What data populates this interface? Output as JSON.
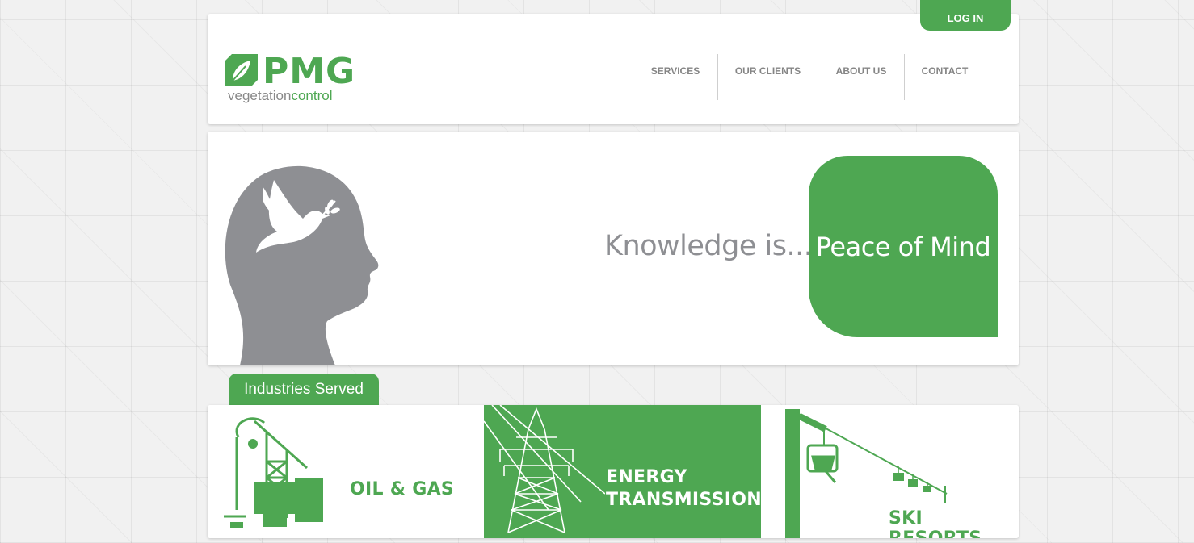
{
  "header": {
    "login_label": "LOG IN",
    "logo": {
      "brand": "PMG",
      "tagline_part1": "vegetation",
      "tagline_part2": "control"
    },
    "nav": [
      {
        "label": "SERVICES"
      },
      {
        "label": "OUR CLIENTS"
      },
      {
        "label": "ABOUT US"
      },
      {
        "label": "CONTACT"
      }
    ]
  },
  "hero": {
    "lead": "Knowledge is...",
    "highlight": "Peace of Mind",
    "illustration": "head-with-dove-icon"
  },
  "industries": {
    "tab_label": "Industries Served",
    "cards": [
      {
        "label": "OIL & GAS",
        "icon": "pumpjack-icon"
      },
      {
        "label_line1": "ENERGY",
        "label_line2": "TRANSMISSION",
        "icon": "power-tower-icon"
      },
      {
        "label": "SKI RESORTS",
        "icon": "ski-lift-icon"
      }
    ]
  },
  "colors": {
    "brand_green": "#4ea752",
    "gray_text": "#8e8f93",
    "nav_text": "#858585"
  }
}
